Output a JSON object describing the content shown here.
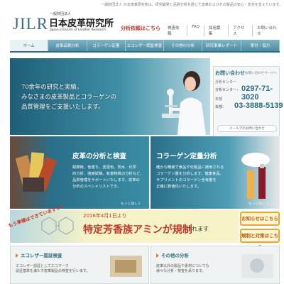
{
  "header": {
    "tagline": "一般財団法人 日本皮革研究所は、研究開発と品質分析を通じて皮革およびその製品の安心・安全を支えています。",
    "logo_abbr": "JILR",
    "logo_ruby": "一般財団法人",
    "logo_jp": "日本皮革研究所",
    "logo_en": "Japan Institute of Leather Research",
    "analysis_label": "分析依頼はこちら",
    "top_links": [
      "検査依頼",
      "FAQ",
      "採用募集",
      "アクセス",
      "お問い合わせ"
    ]
  },
  "nav": {
    "tabs": [
      "ホーム",
      "皮革品質分析",
      "コラーゲン定量",
      "エコレザー認証検査",
      "その他の分析",
      "研究事業レポート",
      "寄付・協力"
    ]
  },
  "hero": {
    "lines": [
      "70余年の研究と実績。",
      "みなさまの皮革製品とコラーゲンの",
      "品質管理をご支援いたします。"
    ]
  },
  "contact": {
    "title": "お問い合わせ",
    "link": "お問い合わせページへ",
    "contact1_label": "分析センター",
    "phone1_label": "分析センター：",
    "phone1": "0297-71-3020",
    "contact2_label": "本部",
    "phone2_label": "本部：",
    "phone2": "03-3888-5139",
    "mail_label": "メールでのお問い合わせ"
  },
  "cards": {
    "leather": {
      "title": "皮革の分析と検査",
      "body": [
        "耐摩耗、色落ち、変退色、防水、化学",
        "的分析、強度試験、有害物質の分析など、",
        "品質管理をサポートいたします。皮革の",
        "分析のスペシャリストです。"
      ],
      "more": "もっと詳しく"
    },
    "collagen": {
      "title": "コラーゲン定量分析",
      "body": [
        "確かな精度で食品や化粧品に使用される",
        "コラーゲン量を分析します。健康食品、",
        "サプリメントのコラーゲン含有量を",
        "正確に数値化いたします。"
      ],
      "more": "もっと詳しく"
    }
  },
  "banner": {
    "date": "2016年4月1日より",
    "main": "特定芳香族アミンが規制",
    "tail": "されます",
    "tilt": "もう準備はできていますか？"
  },
  "side_buttons": [
    "お知らせはこちら",
    "規制と対策はこちら"
  ],
  "bottom": {
    "eco": {
      "title": "エコレザー認証検査",
      "body": [
        "エコレザー認証としてエコマーク",
        "認証基準を満たす皮革製品の検査を行います。"
      ]
    },
    "other": {
      "title": "その他の分析",
      "body": [
        "皮革以外の製品や素材についても",
        "様々な分析・検査を承ります。"
      ]
    }
  },
  "colors": {
    "accent": "#2f6d82",
    "alert": "#c0392b",
    "orange": "#e8a73a"
  }
}
